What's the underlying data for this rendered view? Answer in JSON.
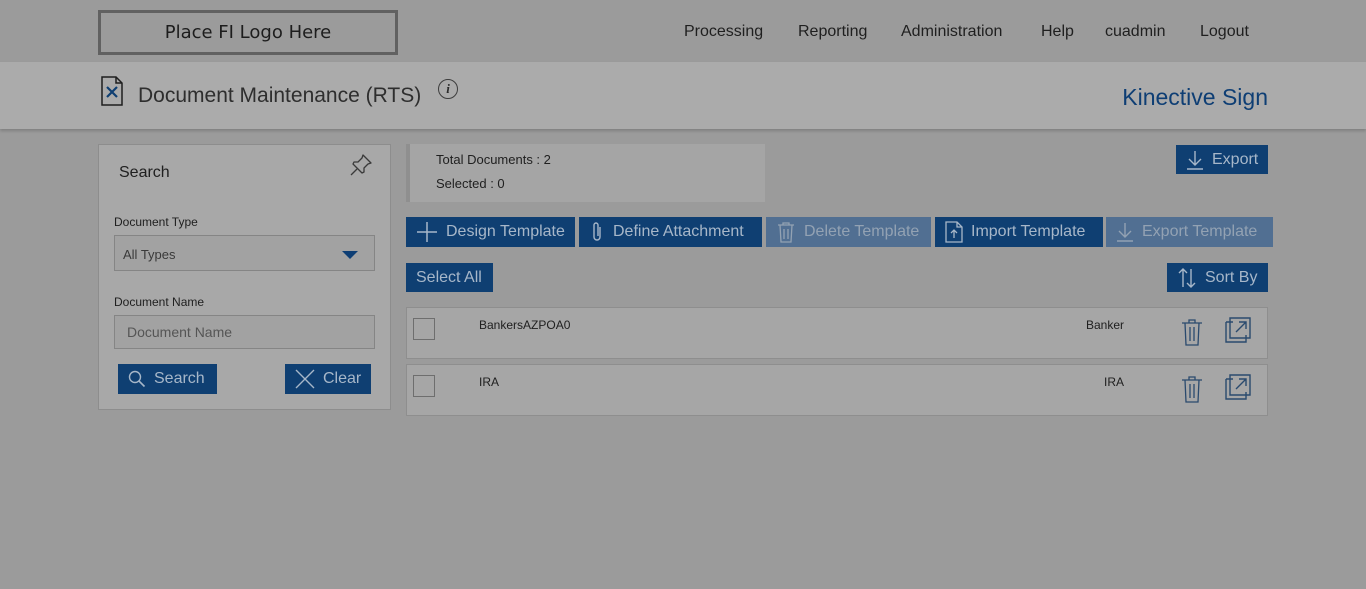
{
  "header": {
    "logo_text": "Place FI Logo Here",
    "nav": [
      "Processing",
      "Reporting",
      "Administration",
      "Help",
      "cuadmin",
      "Logout"
    ]
  },
  "subheader": {
    "title": "Document Maintenance (RTS)",
    "info_icon": "i",
    "brand": "Kinective Sign"
  },
  "search_panel": {
    "title": "Search",
    "document_type_label": "Document Type",
    "document_type_value": "All Types",
    "document_name_label": "Document Name",
    "document_name_placeholder": "Document Name",
    "search_button": "Search",
    "clear_button": "Clear"
  },
  "summary": {
    "total_documents": "Total Documents : 2",
    "selected": "Selected : 0"
  },
  "toolbar": {
    "export": "Export",
    "design_template": "Design Template",
    "define_attachment": "Define Attachment",
    "delete_template": "Delete Template",
    "import_template": "Import Template",
    "export_template": "Export Template",
    "select_all": "Select All",
    "sort_by": "Sort By"
  },
  "documents": [
    {
      "name": "BankersAZPOA0",
      "type": "Banker"
    },
    {
      "name": "IRA",
      "type": "IRA"
    }
  ],
  "colors": {
    "primary": "#0f3f72",
    "disabled": "#516f92",
    "brand_text": "#0e3e74",
    "overlay_background": "#9b9b9b"
  },
  "icons": {
    "page": "document-wrench-icon",
    "info": "info-icon",
    "pin": "pin-icon",
    "search": "magnifier-icon",
    "clear": "close-icon",
    "export": "download-icon",
    "design": "plus-icon",
    "attach": "paperclip-icon",
    "delete": "trash-icon",
    "import": "upload-file-icon",
    "sort": "sort-arrows-icon",
    "open": "external-link-icon"
  }
}
